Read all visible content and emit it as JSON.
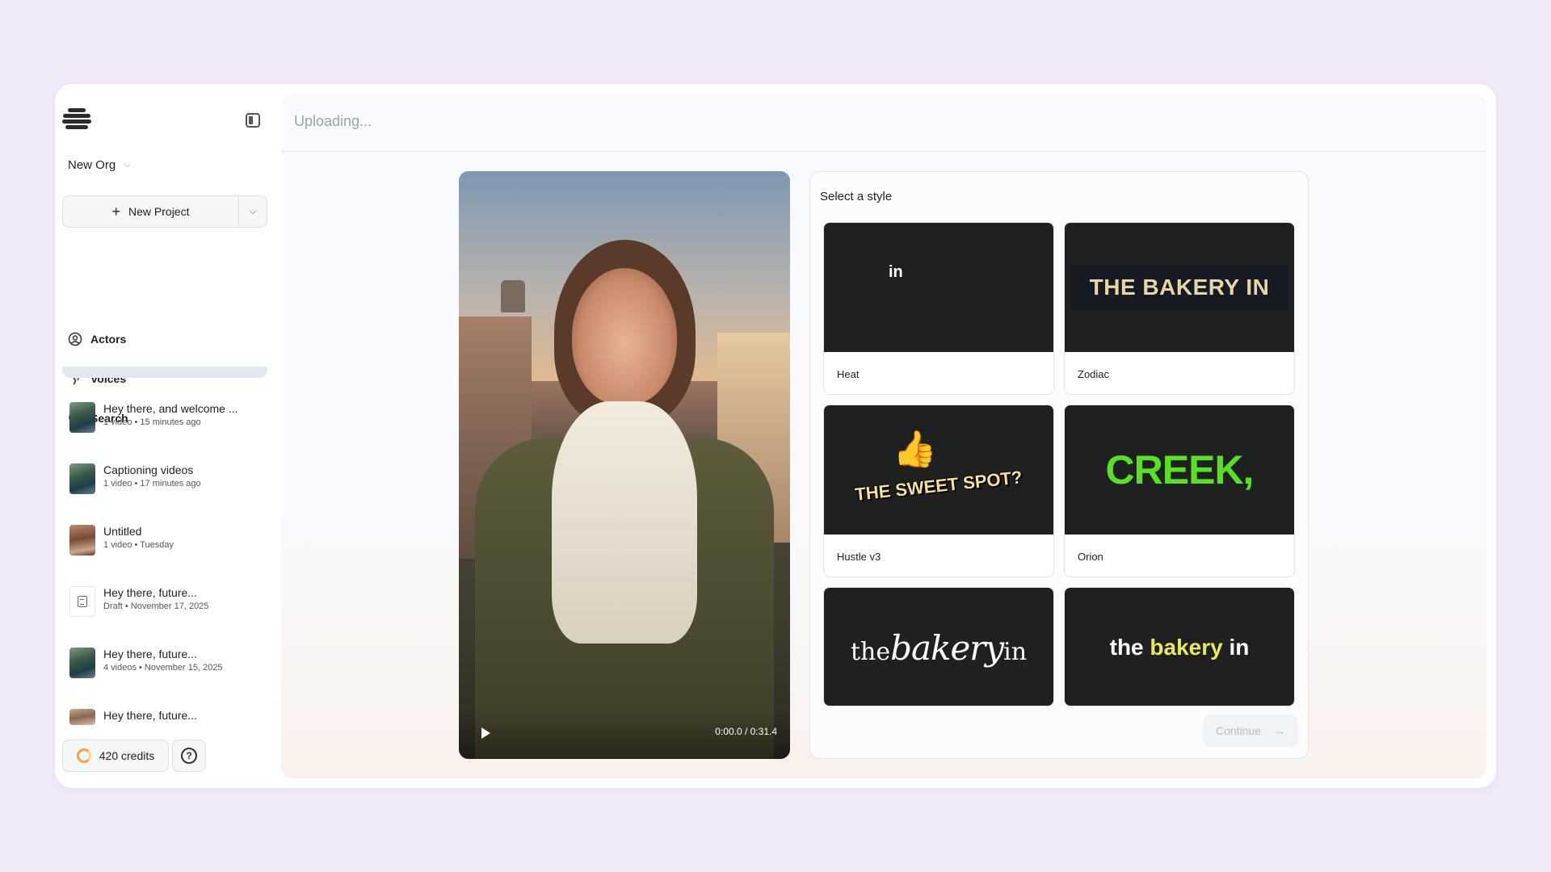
{
  "sidebar": {
    "org_name": "New Org",
    "new_project_label": "New Project",
    "nav": [
      {
        "label": "Actors",
        "icon": "user-circle-icon"
      },
      {
        "label": "Voices",
        "icon": "voice-icon"
      },
      {
        "label": "Search",
        "icon": "search-icon"
      }
    ],
    "projects": [
      {
        "title": "Hey there, and welcome ...",
        "meta": "1 video • 15 minutes ago"
      },
      {
        "title": "Captioning videos",
        "meta": "1 video • 17 minutes ago"
      },
      {
        "title": "Untitled",
        "meta": "1 video • Tuesday"
      },
      {
        "title": "Hey there, future...",
        "meta": "Draft • November 17, 2025"
      },
      {
        "title": "Hey there, future...",
        "meta": "4 videos • November 15, 2025"
      },
      {
        "title": "Hey there, future...",
        "meta": ""
      }
    ],
    "credits_label": "420 credits",
    "help_glyph": "?"
  },
  "header": {
    "title": "Uploading..."
  },
  "video": {
    "time": "0:00.0 / 0:31.4"
  },
  "styles_panel": {
    "title": "Select a style",
    "cards": [
      {
        "name": "Heat",
        "preview_text": "in"
      },
      {
        "name": "Zodiac",
        "preview_text": "THE BAKERY IN"
      },
      {
        "name": "Hustle v3",
        "preview_text": "THE SWEET SPOT?"
      },
      {
        "name": "Orion",
        "preview_text": "CREEK,"
      },
      {
        "name": "",
        "preview_a": "the",
        "preview_b": "bakery",
        "preview_c": "in"
      },
      {
        "name": "",
        "preview_a": "the",
        "preview_b": "bakery",
        "preview_c": "in"
      }
    ],
    "continue_label": "Continue",
    "continue_arrow": "→"
  },
  "colors": {
    "background": "#f1e9f8",
    "accent_green": "#5ae022",
    "accent_yellow": "#e7e85a"
  }
}
